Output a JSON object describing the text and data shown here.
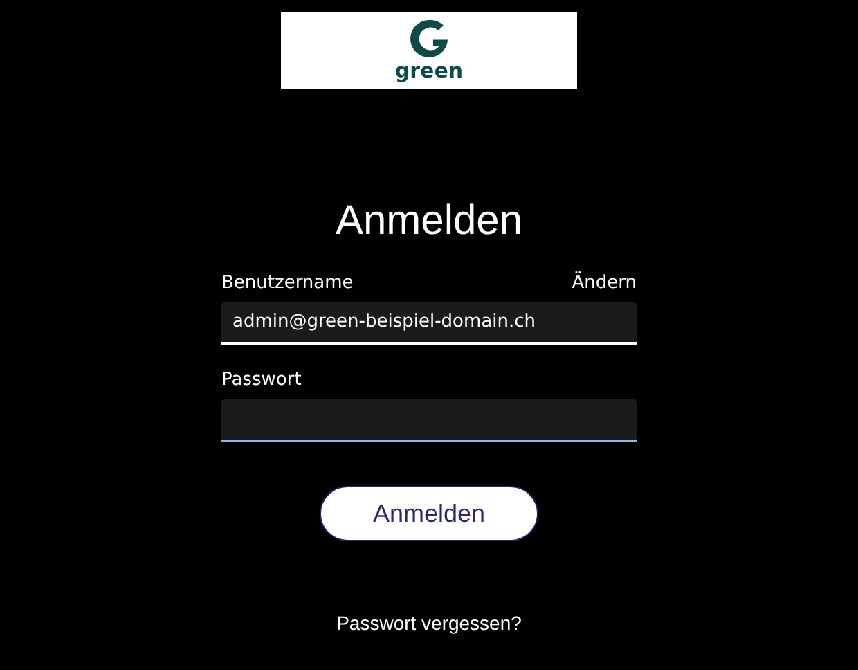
{
  "logo": {
    "text": "green"
  },
  "title": "Anmelden",
  "fields": [
    {
      "label": "Benutzername",
      "action": "Ändern",
      "value": "admin@green-beispiel-domain.ch",
      "focused": true
    },
    {
      "label": "Passwort",
      "focused": false
    }
  ],
  "submit_button": "Anmelden",
  "forgot_link": "Passwort vergessen?"
}
